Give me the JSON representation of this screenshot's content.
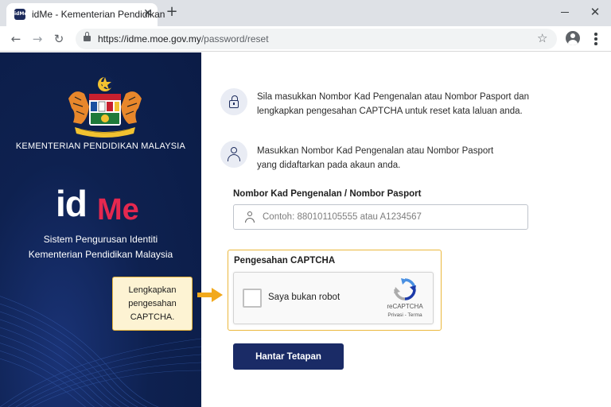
{
  "browser": {
    "tab_title": "idMe - Kementerian Pendidikan",
    "favicon_text": "idMe",
    "url_host": "https://idme.moe.gov.my",
    "url_path": "/password/reset",
    "icons": [
      "back-arrow-icon",
      "forward-arrow-icon",
      "reload-icon",
      "lock-icon",
      "star-icon",
      "profile-icon",
      "menu-icon",
      "close-icon",
      "plus-icon",
      "minimize-icon"
    ]
  },
  "left_panel": {
    "ministry_name": "KEMENTERIAN PENDIDIKAN MALAYSIA",
    "logo_id": "id",
    "logo_me": "Me",
    "system_line1": "Sistem Pengurusan Identiti",
    "system_line2": "Kementerian Pendidikan Malaysia",
    "callout_text": "Lengkapkan pengesahan CAPTCHA.",
    "colors": {
      "background": "#0e2150",
      "accent_red": "#e5284f",
      "callout_bg": "#fdf3d3",
      "callout_border": "#e9b43a"
    }
  },
  "main": {
    "info1_line1": "Sila masukkan Nombor Kad Pengenalan atau Nombor Pasport dan",
    "info1_line2": "lengkapkan pengesahan CAPTCHA untuk reset kata laluan anda.",
    "info2_line1": "Masukkan Nombor Kad Pengenalan atau Nombor Pasport",
    "info2_line2": "yang didaftarkan pada akaun anda.",
    "id_field_label": "Nombor Kad Pengenalan / Nombor Pasport",
    "id_field_placeholder": "Contoh: 880101105555 atau A1234567",
    "id_field_value": "",
    "captcha_title": "Pengesahan CAPTCHA",
    "captcha_checkbox_label": "Saya bukan robot",
    "captcha_checked": false,
    "captcha_brand": "reCAPTCHA",
    "captcha_links": "Privasi - Terma",
    "submit_label": "Hantar Tetapan",
    "colors": {
      "primary": "#1a2b66",
      "highlight": "#ebb83d"
    }
  }
}
